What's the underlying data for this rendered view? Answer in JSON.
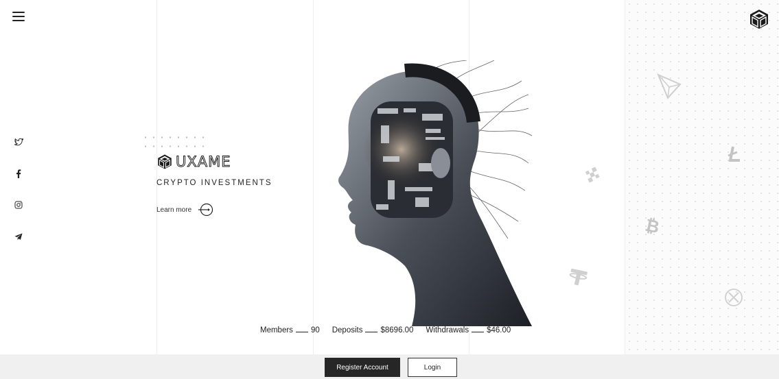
{
  "brand": {
    "name": "UXAME",
    "tagline": "CRYPTO INVESTMENTS",
    "logo_icon": "cube-icon"
  },
  "nav": {
    "menu_icon": "hamburger-menu-icon"
  },
  "hero": {
    "learn_more_label": "Learn more",
    "image": "ai-head-illustration"
  },
  "social": [
    "twitter-icon",
    "facebook-icon",
    "instagram-icon",
    "telegram-icon"
  ],
  "stats": {
    "members_label": "Members",
    "members_value": "90",
    "deposits_label": "Deposits",
    "deposits_value": "$8696.00",
    "withdrawals_label": "Withdrawals",
    "withdrawals_value": "$46.00"
  },
  "footer": {
    "register_label": "Register Account",
    "login_label": "Login"
  },
  "coins": [
    "tron-icon",
    "litecoin-icon",
    "binance-icon",
    "bitcoin-icon",
    "tether-icon",
    "ripple-icon"
  ],
  "colors": {
    "dark": "#262626",
    "footer_bg": "#f0f0f0",
    "coin_gray": "#c4c4c4"
  }
}
